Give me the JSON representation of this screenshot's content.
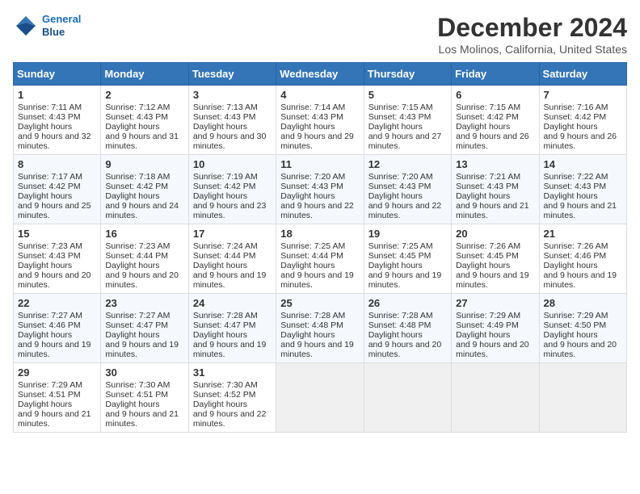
{
  "header": {
    "logo_line1": "General",
    "logo_line2": "Blue",
    "month": "December 2024",
    "location": "Los Molinos, California, United States"
  },
  "days_of_week": [
    "Sunday",
    "Monday",
    "Tuesday",
    "Wednesday",
    "Thursday",
    "Friday",
    "Saturday"
  ],
  "weeks": [
    [
      {
        "day": 1,
        "sunrise": "7:11 AM",
        "sunset": "4:43 PM",
        "daylight": "9 hours and 32 minutes."
      },
      {
        "day": 2,
        "sunrise": "7:12 AM",
        "sunset": "4:43 PM",
        "daylight": "9 hours and 31 minutes."
      },
      {
        "day": 3,
        "sunrise": "7:13 AM",
        "sunset": "4:43 PM",
        "daylight": "9 hours and 30 minutes."
      },
      {
        "day": 4,
        "sunrise": "7:14 AM",
        "sunset": "4:43 PM",
        "daylight": "9 hours and 29 minutes."
      },
      {
        "day": 5,
        "sunrise": "7:15 AM",
        "sunset": "4:43 PM",
        "daylight": "9 hours and 27 minutes."
      },
      {
        "day": 6,
        "sunrise": "7:15 AM",
        "sunset": "4:42 PM",
        "daylight": "9 hours and 26 minutes."
      },
      {
        "day": 7,
        "sunrise": "7:16 AM",
        "sunset": "4:42 PM",
        "daylight": "9 hours and 26 minutes."
      }
    ],
    [
      {
        "day": 8,
        "sunrise": "7:17 AM",
        "sunset": "4:42 PM",
        "daylight": "9 hours and 25 minutes."
      },
      {
        "day": 9,
        "sunrise": "7:18 AM",
        "sunset": "4:42 PM",
        "daylight": "9 hours and 24 minutes."
      },
      {
        "day": 10,
        "sunrise": "7:19 AM",
        "sunset": "4:42 PM",
        "daylight": "9 hours and 23 minutes."
      },
      {
        "day": 11,
        "sunrise": "7:20 AM",
        "sunset": "4:43 PM",
        "daylight": "9 hours and 22 minutes."
      },
      {
        "day": 12,
        "sunrise": "7:20 AM",
        "sunset": "4:43 PM",
        "daylight": "9 hours and 22 minutes."
      },
      {
        "day": 13,
        "sunrise": "7:21 AM",
        "sunset": "4:43 PM",
        "daylight": "9 hours and 21 minutes."
      },
      {
        "day": 14,
        "sunrise": "7:22 AM",
        "sunset": "4:43 PM",
        "daylight": "9 hours and 21 minutes."
      }
    ],
    [
      {
        "day": 15,
        "sunrise": "7:23 AM",
        "sunset": "4:43 PM",
        "daylight": "9 hours and 20 minutes."
      },
      {
        "day": 16,
        "sunrise": "7:23 AM",
        "sunset": "4:44 PM",
        "daylight": "9 hours and 20 minutes."
      },
      {
        "day": 17,
        "sunrise": "7:24 AM",
        "sunset": "4:44 PM",
        "daylight": "9 hours and 19 minutes."
      },
      {
        "day": 18,
        "sunrise": "7:25 AM",
        "sunset": "4:44 PM",
        "daylight": "9 hours and 19 minutes."
      },
      {
        "day": 19,
        "sunrise": "7:25 AM",
        "sunset": "4:45 PM",
        "daylight": "9 hours and 19 minutes."
      },
      {
        "day": 20,
        "sunrise": "7:26 AM",
        "sunset": "4:45 PM",
        "daylight": "9 hours and 19 minutes."
      },
      {
        "day": 21,
        "sunrise": "7:26 AM",
        "sunset": "4:46 PM",
        "daylight": "9 hours and 19 minutes."
      }
    ],
    [
      {
        "day": 22,
        "sunrise": "7:27 AM",
        "sunset": "4:46 PM",
        "daylight": "9 hours and 19 minutes."
      },
      {
        "day": 23,
        "sunrise": "7:27 AM",
        "sunset": "4:47 PM",
        "daylight": "9 hours and 19 minutes."
      },
      {
        "day": 24,
        "sunrise": "7:28 AM",
        "sunset": "4:47 PM",
        "daylight": "9 hours and 19 minutes."
      },
      {
        "day": 25,
        "sunrise": "7:28 AM",
        "sunset": "4:48 PM",
        "daylight": "9 hours and 19 minutes."
      },
      {
        "day": 26,
        "sunrise": "7:28 AM",
        "sunset": "4:48 PM",
        "daylight": "9 hours and 20 minutes."
      },
      {
        "day": 27,
        "sunrise": "7:29 AM",
        "sunset": "4:49 PM",
        "daylight": "9 hours and 20 minutes."
      },
      {
        "day": 28,
        "sunrise": "7:29 AM",
        "sunset": "4:50 PM",
        "daylight": "9 hours and 20 minutes."
      }
    ],
    [
      {
        "day": 29,
        "sunrise": "7:29 AM",
        "sunset": "4:51 PM",
        "daylight": "9 hours and 21 minutes."
      },
      {
        "day": 30,
        "sunrise": "7:30 AM",
        "sunset": "4:51 PM",
        "daylight": "9 hours and 21 minutes."
      },
      {
        "day": 31,
        "sunrise": "7:30 AM",
        "sunset": "4:52 PM",
        "daylight": "9 hours and 22 minutes."
      },
      null,
      null,
      null,
      null
    ]
  ]
}
